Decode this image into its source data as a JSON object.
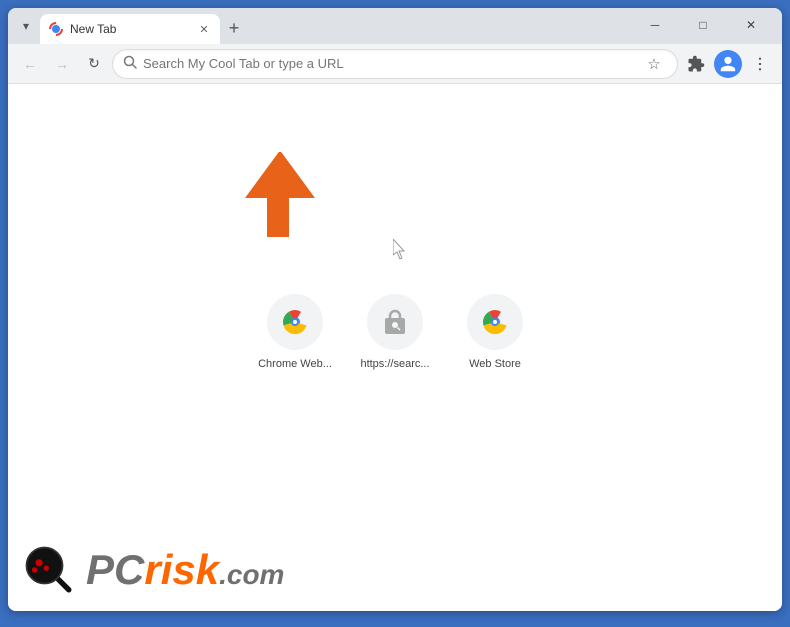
{
  "window": {
    "title": "New Tab",
    "controls": {
      "minimize": "─",
      "maximize": "□",
      "close": "✕"
    }
  },
  "tab": {
    "title": "New Tab",
    "new_tab_label": "+"
  },
  "nav": {
    "back_label": "←",
    "forward_label": "→",
    "reload_label": "↻",
    "address_placeholder": "Search My Cool Tab or type a URL"
  },
  "shortcuts": [
    {
      "label": "Chrome Web...",
      "icon_type": "chrome"
    },
    {
      "label": "https://searc...",
      "icon_type": "search-box"
    },
    {
      "label": "Web Store",
      "icon_type": "chrome"
    }
  ],
  "watermark": {
    "pc_text": "PC",
    "risk_text": "risk",
    "dot_com_text": ".com"
  }
}
